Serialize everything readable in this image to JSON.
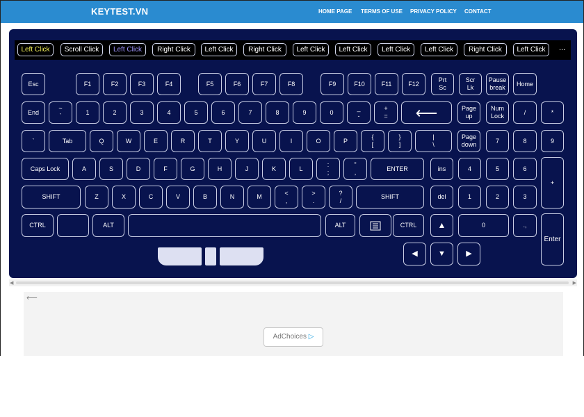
{
  "header": {
    "logo": "KEYTEST.VN",
    "nav": [
      "HOME PAGE",
      "TERMS OF USE",
      "PRIVACY POLICY",
      "CONTACT"
    ],
    "bg": "#2a8bd0"
  },
  "click_log": {
    "items": [
      "Left Click",
      "Scroll Click",
      "Left Click",
      "Right Click",
      "Left Click",
      "Right Click",
      "Left Click",
      "Left Click",
      "Left Click",
      "Left Click",
      "Right Click",
      "Left Click"
    ],
    "more": "..."
  },
  "keys": {
    "esc": "Esc",
    "f1": "F1",
    "f2": "F2",
    "f3": "F3",
    "f4": "F4",
    "f5": "F5",
    "f6": "F6",
    "f7": "F7",
    "f8": "F8",
    "f9": "F9",
    "f10": "F10",
    "f11": "F11",
    "f12": "F12",
    "prtsc_1": "Prt",
    "prtsc_2": "Sc",
    "scrlk_1": "Scr",
    "scrlk_2": "Lk",
    "pause_1": "Pause",
    "pause_2": "break",
    "home": "Home",
    "end": "End",
    "tilde_1": "~",
    "tilde_2": "`",
    "d1": "1",
    "d2": "2",
    "d3": "3",
    "d4": "4",
    "d5": "5",
    "d6": "6",
    "d7": "7",
    "d8": "8",
    "d9": "9",
    "d0": "0",
    "minus_1": "_",
    "minus_2": "-",
    "plus_1": "+",
    "plus_2": "=",
    "backspace": "⟵",
    "pgup_1": "Page",
    "pgup_2": "up",
    "numlock_1": "Num",
    "numlock_2": "Lock",
    "slash": "/",
    "star": "*",
    "tick": "`",
    "tab": "Tab",
    "q": "Q",
    "w": "W",
    "e": "E",
    "r": "R",
    "t": "T",
    "y": "Y",
    "u": "U",
    "i": "I",
    "o": "O",
    "p": "P",
    "lbr_1": "{",
    "lbr_2": "[",
    "rbr_1": "}",
    "rbr_2": "]",
    "pipe_1": "|",
    "pipe_2": "\\",
    "pgdn_1": "Page",
    "pgdn_2": "down",
    "n7": "7",
    "n8": "8",
    "n9": "9",
    "caps": "Caps Lock",
    "a": "A",
    "s": "S",
    "d": "D",
    "f": "F",
    "g": "G",
    "h": "H",
    "j": "J",
    "k": "K",
    "l": "L",
    "semi_1": ":",
    "semi_2": ";",
    "quote_1": "\"",
    "quote_2": ",",
    "enter": "ENTER",
    "ins": "ins",
    "n4": "4",
    "n5": "5",
    "n6": "6",
    "nplus": "+",
    "lshift": "SHIFT",
    "z": "Z",
    "x": "X",
    "c": "C",
    "v": "V",
    "b": "B",
    "n": "N",
    "m": "M",
    "lt_1": "<",
    "lt_2": ",",
    "gt_1": ">",
    "gt_2": ".",
    "q_1": "?",
    "q_2": "/",
    "rshift": "SHIFT",
    "del": "del",
    "n1": "1",
    "n2": "2",
    "n3": "3",
    "lctrl": "CTRL",
    "lalt": "ALT",
    "ralt": "ALT",
    "rctrl": "CTRL",
    "up": "▲",
    "n0": "0",
    "ndot": ".,",
    "nenter": "Enter",
    "left": "◀",
    "down": "▼",
    "right": "▶"
  },
  "ad": {
    "back": "⟵",
    "choices": "AdChoices",
    "choices_mark": "▷"
  },
  "colors": {
    "board": "#08134e",
    "key_border": "#c8cde4",
    "yellow": "#f1ef5a",
    "purple": "#9f94ff"
  }
}
